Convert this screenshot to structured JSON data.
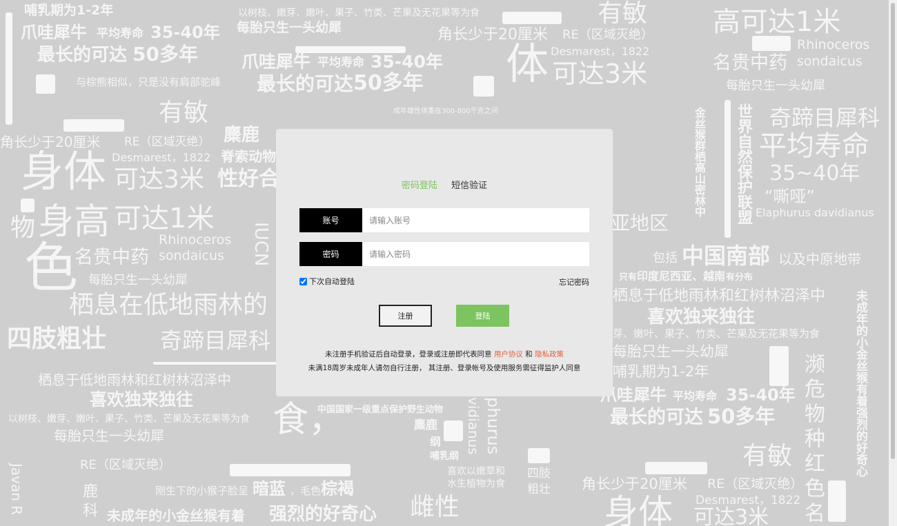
{
  "login": {
    "tabs": [
      {
        "label": "密码登陆",
        "active": true
      },
      {
        "label": "短信验证",
        "active": false
      }
    ],
    "account_label": "账号",
    "account_placeholder": "请输入账号",
    "password_label": "密码",
    "password_placeholder": "请输入密码",
    "auto_login_label": "下次自动登陆",
    "auto_login_checked": true,
    "forgot_label": "忘记密码",
    "register_label": "注册",
    "login_label": "登陆",
    "terms": {
      "prefix": "未注册手机验证后自动登录，登录或注册即代表同意",
      "user_agreement": "用户协议",
      "and": "和",
      "privacy": "隐私政策",
      "minor_notice": "未满18周岁未成年人请勿自行注册， 其注册、登录帐号及使用服务需征得监护人同意"
    }
  },
  "colors": {
    "accent": "#7cc45f",
    "link": "#e0623a",
    "label_bg": "#000000"
  },
  "background": {
    "words": [
      "哺乳期为1-2年",
      "爪哇犀牛",
      "平均寿命",
      "35-40年",
      "最长的可达",
      "50多年",
      "与棕熊相似，只是没有肩部驼峰",
      "以树枝、嫩芽、嫩叶、果子、竹类、芒果及无花果等为食",
      "每胎只生一头幼犀",
      "爪哇犀牛",
      "平均寿命",
      "35-40年",
      "最长的可达",
      "50多年",
      "有敏",
      "角长少于20厘米",
      "RE（区域灭绝）",
      "体",
      "可达3米",
      "Desmarest，1822",
      "高可达1米",
      "Rhinoceros",
      "名贵中药",
      "sondaicus",
      "每胎只生一头幼犀",
      "有敏",
      "麋鹿",
      "角长少于20厘米",
      "RE（区域灭绝）",
      "Desmarest，1822",
      "脊索动物",
      "身体",
      "可达3米",
      "性好合",
      "奇蹄目犀科",
      "平均寿命",
      "35~40年",
      "“嘶哑”",
      "Elaphurus davidianus",
      "物",
      "身高",
      "可达1米",
      "Rhinoceros",
      "名贵中药",
      "sondaicus",
      "色",
      "每胎只生一头幼犀",
      "栖息在低地雨林的",
      "四肢粗壮",
      "奇蹄目犀科",
      "栖息于低地雨林和红树林沼泽中",
      "喜欢独来独往",
      "以树枝、嫩芽、嫩叶、果子、竹类、芒果及无花果等为食",
      "每胎只生一头幼犀",
      "RE（区域灭绝）",
      "刚生下的小猴子脸呈",
      "暗蓝",
      "，毛色",
      "棕褐",
      "未成年的小金丝猴有着",
      "强烈的好奇心",
      "雌性",
      "鹿",
      "科",
      "包括",
      "中国南部",
      "以及中原地带",
      "只有",
      "印度尼西亚、越南",
      "有分布",
      "栖息于低地雨林和红树林沼泽中",
      "喜欢独来独往",
      "芽、嫩叶、果子、竹类、芒果及无花果等为食",
      "每胎只生一头幼犀",
      "哺乳期为1-2年",
      "爪哇犀牛",
      "平均寿命",
      "35-40年",
      "最长的可达",
      "50多年",
      "有敏",
      "角长少于20厘米",
      "RE（区域灭绝）",
      "Desmarest，1822",
      "身体",
      "可达3米",
      "食，",
      "中国国家一级重点保护野生动物",
      "麋鹿",
      "纲",
      "哺乳纲",
      "喜欢以嫩草和",
      "水生植物为食",
      "四肢",
      "粗壮",
      "亚地区",
      "世界自然保护联盟",
      "金丝猴群栖高山密林中",
      "濒",
      "危",
      "物",
      "种",
      "红",
      "色",
      "名",
      "未成年的小金丝猴有着强烈的好奇心",
      "成年雄性体重在300-800千克之间",
      "IUCN",
      "Javan R",
      "vidianus",
      "phurus"
    ]
  }
}
